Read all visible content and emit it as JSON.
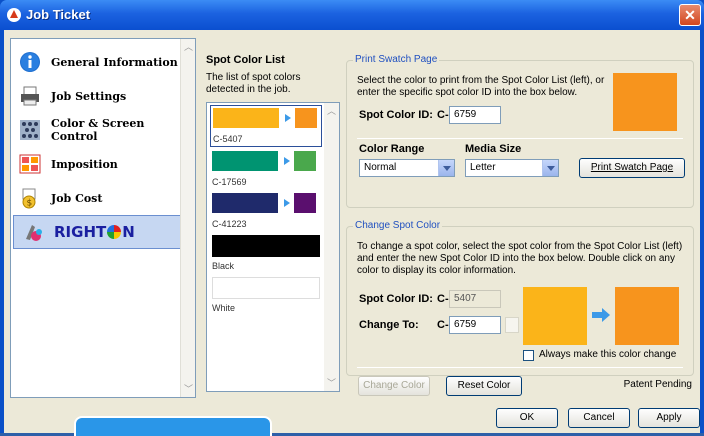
{
  "window": {
    "title": "Job Ticket",
    "close_icon": "close-icon"
  },
  "nav": {
    "items": [
      {
        "label": "General Information",
        "icon": "info-icon"
      },
      {
        "label": "Job Settings",
        "icon": "printer-icon"
      },
      {
        "label": "Color & Screen Control",
        "icon": "halftone-icon"
      },
      {
        "label": "Imposition",
        "icon": "imposition-icon"
      },
      {
        "label": "Job Cost",
        "icon": "money-icon"
      },
      {
        "label": "RIGHT",
        "label_suffix": "N",
        "icon": "righton-icon",
        "selected": true
      }
    ]
  },
  "spot_list": {
    "title": "Spot Color List",
    "description": "The list of spot colors detected in the job.",
    "items": [
      {
        "name": "C-5407",
        "color": "#fbb419",
        "target": "#f7941d",
        "selected": true
      },
      {
        "name": "C-17569",
        "color": "#009471",
        "target": "#4aa84c"
      },
      {
        "name": "C-41223",
        "color": "#1f2a6b",
        "target": "#5a0f6e"
      },
      {
        "name": "Black",
        "color": "#000000"
      },
      {
        "name": "White",
        "color": "#ffffff"
      }
    ]
  },
  "print_swatch": {
    "group_label": "Print Swatch Page",
    "instructions": "Select the color to print from the Spot Color List (left), or enter the specific spot color ID into the box below.",
    "spot_id_label": "Spot Color ID:",
    "prefix": "C-",
    "spot_id_value": "6759",
    "preview_color": "#f7941d",
    "color_range_label": "Color Range",
    "color_range_value": "Normal",
    "media_size_label": "Media Size",
    "media_size_value": "Letter",
    "print_button": "Print Swatch Page"
  },
  "change_spot": {
    "group_label": "Change Spot Color",
    "instructions": "To change a spot color, select the spot color from the Spot Color List (left) and enter the new Spot Color ID into the box below.  Double click on any color to display its color information.",
    "spot_id_label": "Spot Color ID:",
    "spot_prefix": "C-",
    "spot_id_value": "5407",
    "change_to_label": "Change To:",
    "change_prefix": "C-",
    "change_to_value": "6759",
    "from_color": "#fbb419",
    "to_color": "#f7941d",
    "always_label": "Always make this color change",
    "change_button": "Change Color",
    "reset_button": "Reset Color"
  },
  "footer": {
    "patent": "Patent Pending",
    "ok": "OK",
    "cancel": "Cancel",
    "apply": "Apply"
  }
}
